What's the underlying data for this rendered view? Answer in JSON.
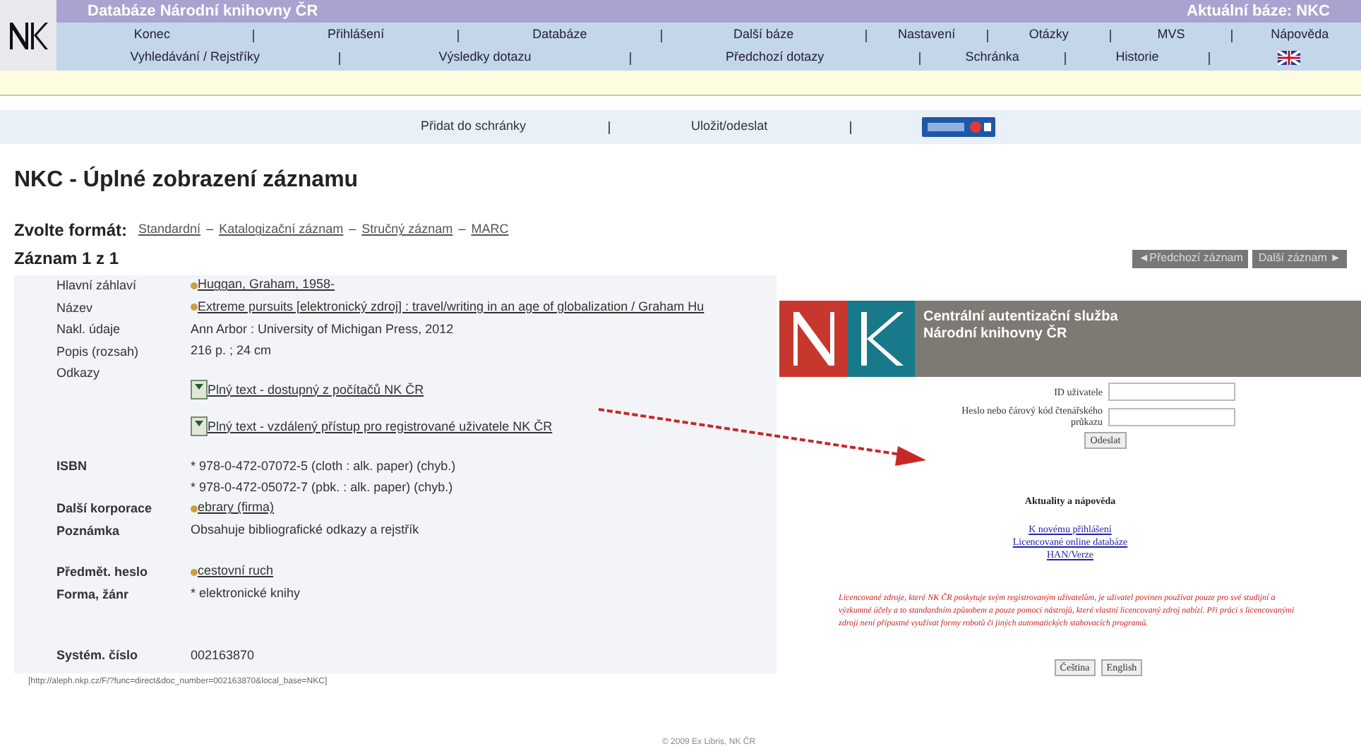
{
  "header": {
    "title": "Databáze Národní knihovny ČR",
    "base": "Aktuální báze: NKC"
  },
  "nav": {
    "row1": [
      "Konec",
      "Přihlášení",
      "Databáze",
      "Další báze",
      "Nastavení",
      "Otázky",
      "MVS",
      "Nápověda"
    ],
    "row2": [
      "Vyhledávání / Rejstříky",
      "Výsledky dotazu",
      "Předchozí dotazy",
      "Schránka",
      "Historie"
    ]
  },
  "toolbar": [
    "Přidat do schránky",
    "Uložit/odeslat"
  ],
  "page_title": "NKC - Úplné zobrazení záznamu",
  "format": {
    "label": "Zvolte formát:",
    "options": [
      "Standardní",
      "Katalogizační záznam",
      "Stručný záznam",
      "MARC"
    ],
    "separator": "–"
  },
  "record_count": "Záznam 1 z 1",
  "record_nav": [
    "◄Předchozí záznam",
    "Další záznam ►"
  ],
  "rows": [
    {
      "kind": "field",
      "label": "Hlavní záhlaví",
      "values": [
        {
          "kind": "bullet-link",
          "text": "Huggan, Graham, 1958-"
        }
      ]
    },
    {
      "kind": "field",
      "label": "Název",
      "values": [
        {
          "kind": "bullet-link",
          "text": "Extreme pursuits [elektronický zdroj] : travel/writing in an age of globalization / Graham Hu"
        }
      ]
    },
    {
      "kind": "field",
      "label": "Nakl. údaje",
      "values": [
        {
          "kind": "text",
          "text": "Ann Arbor : University of Michigan Press, 2012"
        }
      ]
    },
    {
      "kind": "field",
      "label": "Popis (rozsah)",
      "values": [
        {
          "kind": "text",
          "text": "216 p. ; 24 cm"
        }
      ]
    },
    {
      "kind": "field",
      "label": "Odkazy",
      "values": [
        {
          "kind": "doc-link",
          "text": "Plný text - dostupný z počítačů NK ČR"
        },
        {
          "kind": "doc-link",
          "text": "Plný text - vzdálený přístup pro registrované uživatele NK ČR"
        }
      ]
    },
    {
      "kind": "spacer"
    },
    {
      "kind": "field",
      "label": "ISBN",
      "values": [
        {
          "kind": "text",
          "text": "* 978-0-472-07072-5 (cloth : alk. paper) (chyb.)"
        },
        {
          "kind": "text",
          "text": "* 978-0-472-05072-7 (pbk. : alk. paper) (chyb.)"
        }
      ]
    },
    {
      "kind": "field",
      "label": "Další korporace",
      "values": [
        {
          "kind": "bullet-link",
          "text": "ebrary (firma)"
        }
      ]
    },
    {
      "kind": "field",
      "label": "Poznámka",
      "values": [
        {
          "kind": "text",
          "text": "Obsahuje bibliografické odkazy a rejstřík"
        }
      ]
    },
    {
      "kind": "spacer"
    },
    {
      "kind": "field",
      "label": "Předmět. heslo",
      "values": [
        {
          "kind": "bullet-link",
          "text": "cestovní ruch"
        }
      ]
    },
    {
      "kind": "field",
      "label": "Forma, žánr",
      "values": [
        {
          "kind": "text",
          "text": "* elektronické knihy"
        }
      ]
    },
    {
      "kind": "spacer"
    },
    {
      "kind": "spacer"
    },
    {
      "kind": "field",
      "label": "Systém. číslo",
      "values": [
        {
          "kind": "text",
          "text": "002163870"
        }
      ]
    }
  ],
  "url": "[http://aleph.nkp.cz/F/?func=direct&doc_number=002163870&local_base=NKC]",
  "footer": "© 2009 Ex Libris, NK ČR",
  "login": {
    "title_lines": [
      "Centrální autentizační služba",
      "Národní knihovny ČR"
    ],
    "fields": [
      {
        "label": "ID uživatele"
      },
      {
        "label": "Heslo nebo čárový kód čtenářského průkazu"
      }
    ],
    "submit": "Odeslat",
    "news_title": "Aktuality a nápověda",
    "links": [
      "K novému přihlášení",
      "Licencované online databáze",
      "HAN/Verze"
    ],
    "notice": "Licencované zdroje, které NK ČR poskytuje svým registrovaným uživatelům, je uživatel povinen používat pouze pro své studijní a výzkumné účely a to standardním způsobem a pouze pomocí nástrojů, které vlastní licencovaný zdroj nabízí. Při práci s licencovanými zdroji není přípustné využívat formy robotů či jiných automatických stahovacích programů.",
    "languages": [
      "Čeština",
      "English"
    ]
  }
}
